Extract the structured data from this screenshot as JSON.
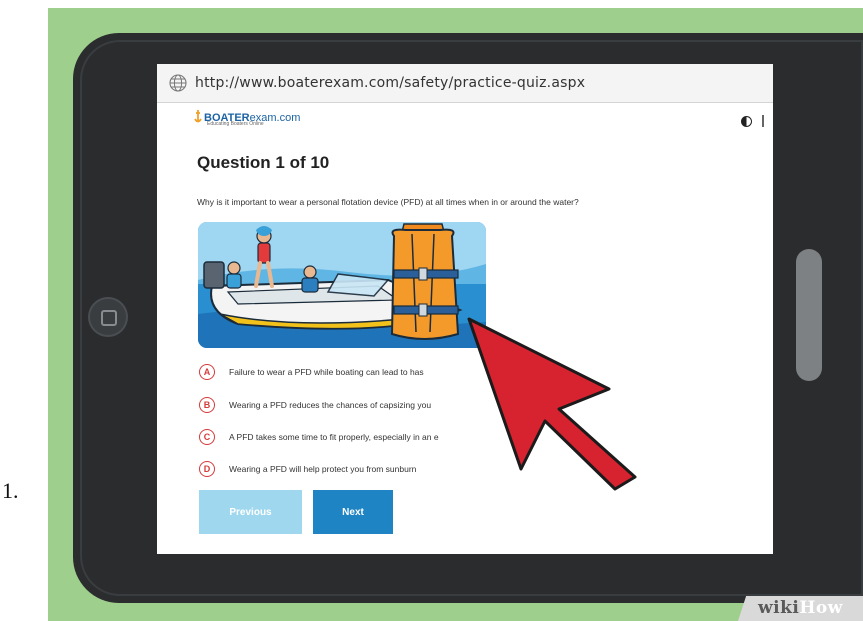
{
  "list_number": "1.",
  "browser": {
    "url": "http://www.boaterexam.com/safety/practice-quiz.aspx",
    "icon": "globe-icon"
  },
  "logo": {
    "brand_bold": "BOATER",
    "brand_light": "exam.com",
    "tagline": "Educating Boaters Online"
  },
  "quiz": {
    "title": "Question 1 of 10",
    "question": "Why is it important to wear a personal flotation device (PFD) at all times when in or around the water?",
    "answers": [
      {
        "letter": "A",
        "text": "Failure to wear a PFD while boating can lead to has"
      },
      {
        "letter": "B",
        "text": "Wearing a PFD reduces the chances of capsizing you"
      },
      {
        "letter": "C",
        "text": "A PFD takes some time to fit properly, especially in an e"
      },
      {
        "letter": "D",
        "text": "Wearing a PFD will help protect you from sunburn"
      }
    ],
    "previous_label": "Previous",
    "next_label": "Next"
  },
  "watermark": {
    "part1": "wiki",
    "part2": "How"
  },
  "colors": {
    "backdrop": "#9fcf8c",
    "tablet": "#2a2c2e",
    "accent_blue": "#1f84c4",
    "disabled_blue": "#9fd8ee",
    "answer_red": "#d73a3a",
    "cursor_red": "#d7222f"
  }
}
